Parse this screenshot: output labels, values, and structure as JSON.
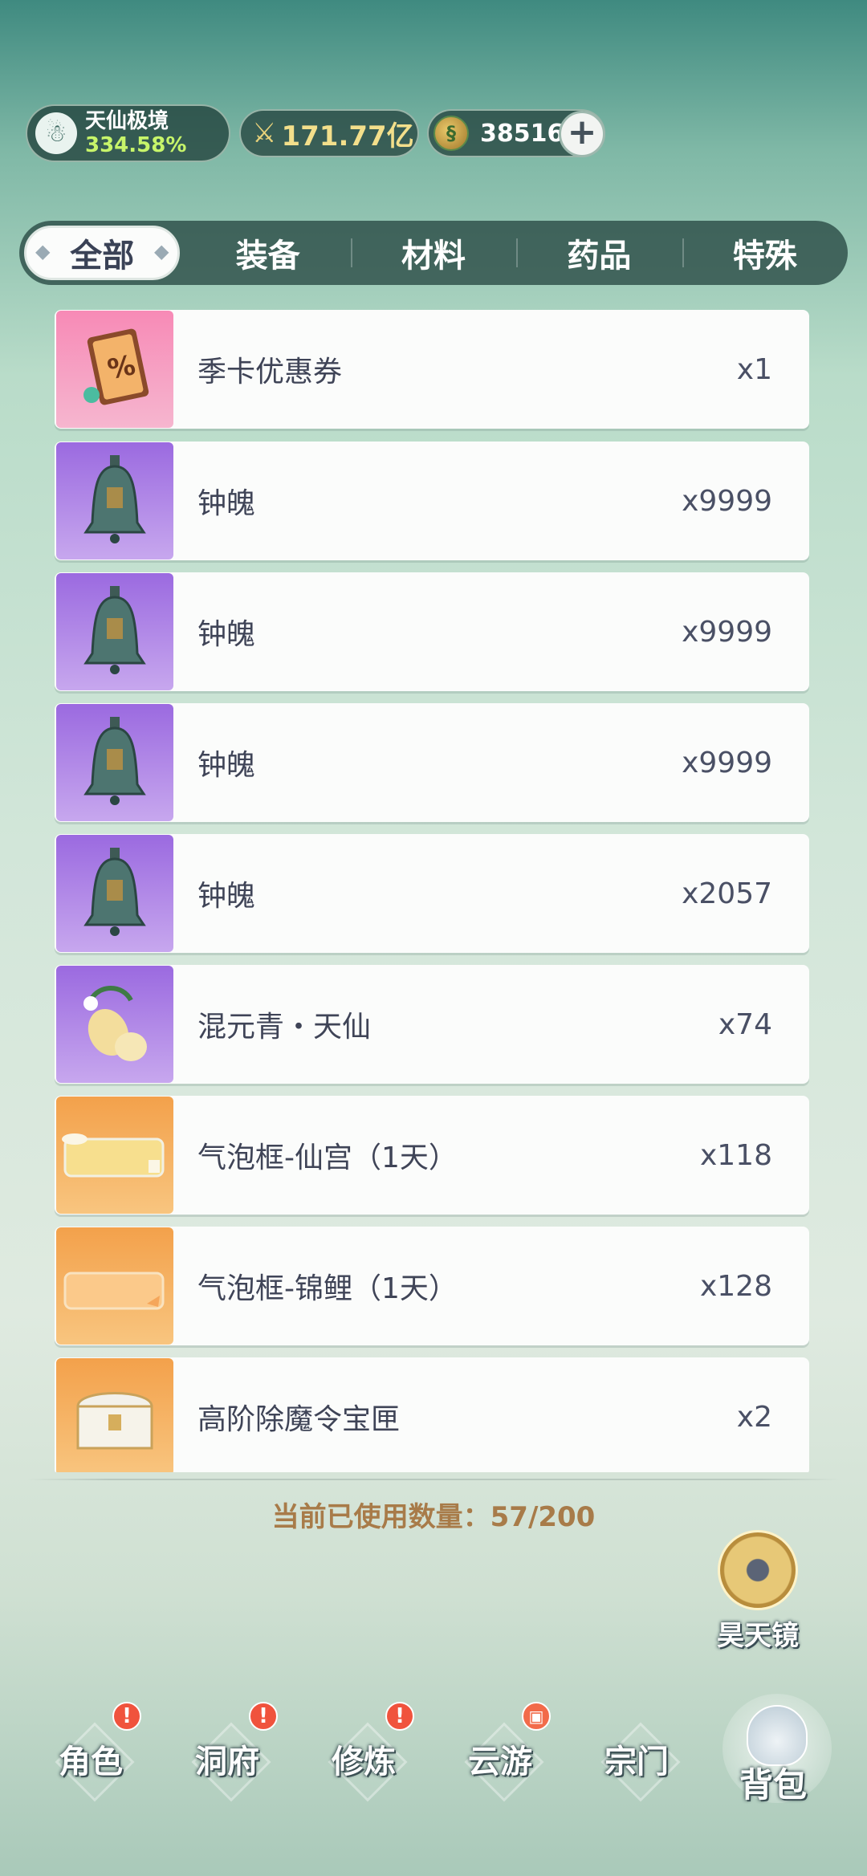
{
  "header": {
    "realm": {
      "name": "天仙极境",
      "percent": "334.58%"
    },
    "power": {
      "value": "171.77亿"
    },
    "coins": {
      "value": "38516",
      "add_label": "+"
    }
  },
  "tabs": [
    {
      "label": "全部",
      "active": true
    },
    {
      "label": "装备",
      "active": false
    },
    {
      "label": "材料",
      "active": false
    },
    {
      "label": "药品",
      "active": false
    },
    {
      "label": "特殊",
      "active": false
    }
  ],
  "items": [
    {
      "name": "季卡优惠券",
      "qty": "x1",
      "icon": "coupon-icon",
      "bg": "pink"
    },
    {
      "name": "钟魄",
      "qty": "x9999",
      "icon": "bell-icon",
      "bg": "purple"
    },
    {
      "name": "钟魄",
      "qty": "x9999",
      "icon": "bell-icon",
      "bg": "purple"
    },
    {
      "name": "钟魄",
      "qty": "x9999",
      "icon": "bell-icon",
      "bg": "purple"
    },
    {
      "name": "钟魄",
      "qty": "x2057",
      "icon": "bell-icon",
      "bg": "purple"
    },
    {
      "name": "混元青・天仙",
      "qty": "x74",
      "icon": "gourd-icon",
      "bg": "purple"
    },
    {
      "name": "气泡框-仙宫（1天）",
      "qty": "x118",
      "icon": "bubble-frame-icon",
      "bg": "orange"
    },
    {
      "name": "气泡框-锦鲤（1天）",
      "qty": "x128",
      "icon": "bubble-frame-icon",
      "bg": "orange"
    },
    {
      "name": "高阶除魔令宝匣",
      "qty": "x2",
      "icon": "treasure-chest-icon",
      "bg": "orange"
    }
  ],
  "footer": {
    "capacity_text": "当前已使用数量：57/200",
    "mirror_label": "昊天镜"
  },
  "nav": [
    {
      "label": "角色",
      "badge": "!"
    },
    {
      "label": "洞府",
      "badge": "!"
    },
    {
      "label": "修炼",
      "badge": "!"
    },
    {
      "label": "云游",
      "badge": "gift"
    },
    {
      "label": "宗门",
      "badge": ""
    },
    {
      "label": "背包",
      "badge": "",
      "active": true
    }
  ]
}
